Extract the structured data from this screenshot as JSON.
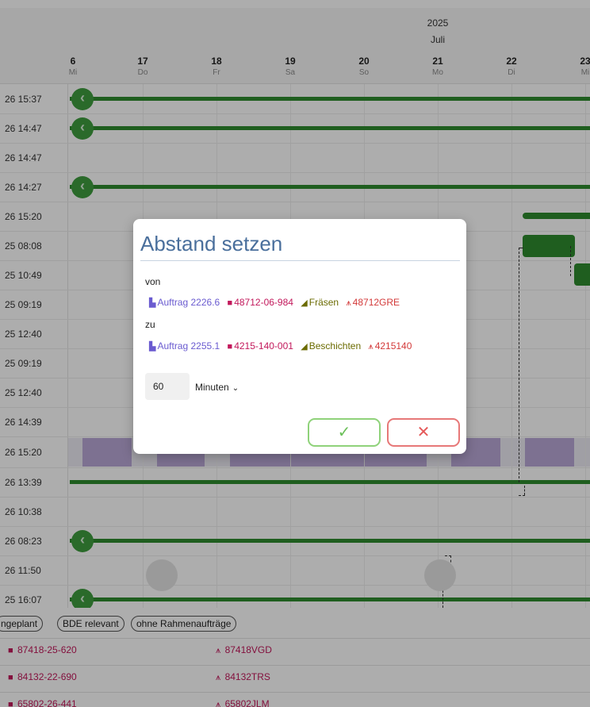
{
  "header": {
    "year": "2025",
    "month": "Juli",
    "days": [
      {
        "num": "6",
        "wd": "Mi"
      },
      {
        "num": "17",
        "wd": "Do"
      },
      {
        "num": "18",
        "wd": "Fr"
      },
      {
        "num": "19",
        "wd": "Sa"
      },
      {
        "num": "20",
        "wd": "So"
      },
      {
        "num": "21",
        "wd": "Mo"
      },
      {
        "num": "22",
        "wd": "Di"
      },
      {
        "num": "23",
        "wd": "Mi"
      }
    ]
  },
  "rows": [
    "26 15:37",
    "26 14:47",
    "26 14:47",
    "26 14:27",
    "26 15:20",
    "25 08:08",
    "25 10:49",
    "25 09:19",
    "25 12:40",
    "25 09:19",
    "25 12:40",
    "26 14:39",
    "26 15:20",
    "26 13:39",
    "26 10:38",
    "26 08:23",
    "26 11:50",
    "25 16:07"
  ],
  "dialog": {
    "title": "Abstand setzen",
    "from_label": "von",
    "from": {
      "auftrag": "Auftrag 2226.6",
      "nummer": "48712-06-984",
      "arbeitsgang": "Fräsen",
      "teil": "48712GRE"
    },
    "to_label": "zu",
    "to": {
      "auftrag": "Auftrag 2255.1",
      "nummer": "4215-140-001",
      "arbeitsgang": "Beschichten",
      "teil": "4215140"
    },
    "minutes_value": "60",
    "unit": "Minuten",
    "confirm_icon": "check-icon",
    "cancel_icon": "close-icon"
  },
  "filters": [
    "ngeplant",
    "BDE relevant",
    "ohne Rahmenaufträge"
  ],
  "table": [
    {
      "nummer": "87418-25-620",
      "teil": "87418VGD"
    },
    {
      "nummer": "84132-22-690",
      "teil": "84132TRS"
    },
    {
      "nummer": "65802-26-441",
      "teil": "65802JLM"
    }
  ],
  "colors": {
    "bar": "#2e8b2e",
    "title": "#4a6f9c",
    "auftrag": "#6a5bd0",
    "nummer": "#c2185b",
    "arbeitsgang": "#6b6b00",
    "teil": "#d33a3a",
    "confirm": "#6cc05a",
    "cancel": "#e55a5a"
  }
}
